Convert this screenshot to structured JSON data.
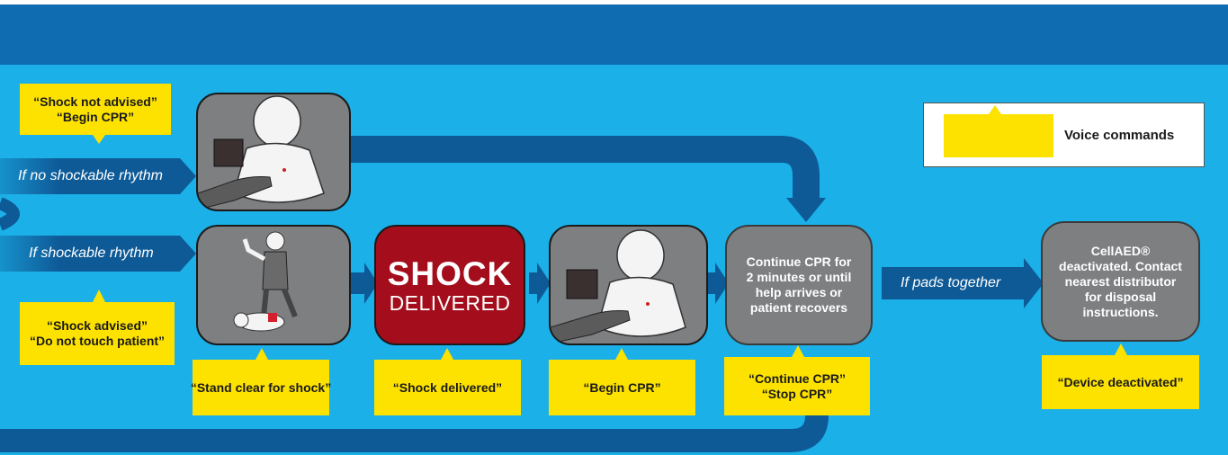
{
  "header": {
    "color": "#0f6cb1"
  },
  "colors": {
    "background": "#1bb0e8",
    "flow": "#0e5a97",
    "voice_box": "#fde200",
    "panel": "#7e7f81",
    "shock": "#a40e1c"
  },
  "branches": {
    "no_shock": "If no shockable rhythm",
    "shock": "If shockable rhythm",
    "pads_together": "If pads together"
  },
  "voice": {
    "no_shock": [
      "“Shock not advised”",
      "“Begin CPR”"
    ],
    "shock": [
      "“Shock advised”",
      "“Do not touch patient”"
    ],
    "stand_clear": "“Stand clear for shock”",
    "shock_delivered": "“Shock delivered”",
    "begin_cpr": "“Begin CPR”",
    "continue": [
      "“Continue CPR”",
      "“Stop CPR”"
    ],
    "deactivated": "“Device deactivated”"
  },
  "steps": {
    "shock_word": "SHOCK",
    "delivered_word": "DELIVERED",
    "continue_cpr": [
      "Continue CPR for",
      "2 minutes or until",
      "help arrives or",
      "patient recovers"
    ],
    "deactivated": [
      "CellAED®",
      "deactivated. Contact",
      "nearest distributor",
      "for disposal",
      "instructions."
    ]
  },
  "legend": {
    "label": "Voice commands"
  },
  "icons": [
    "infant-cpr-icon",
    "stand-clear-icon",
    "infant-cpr-icon"
  ]
}
